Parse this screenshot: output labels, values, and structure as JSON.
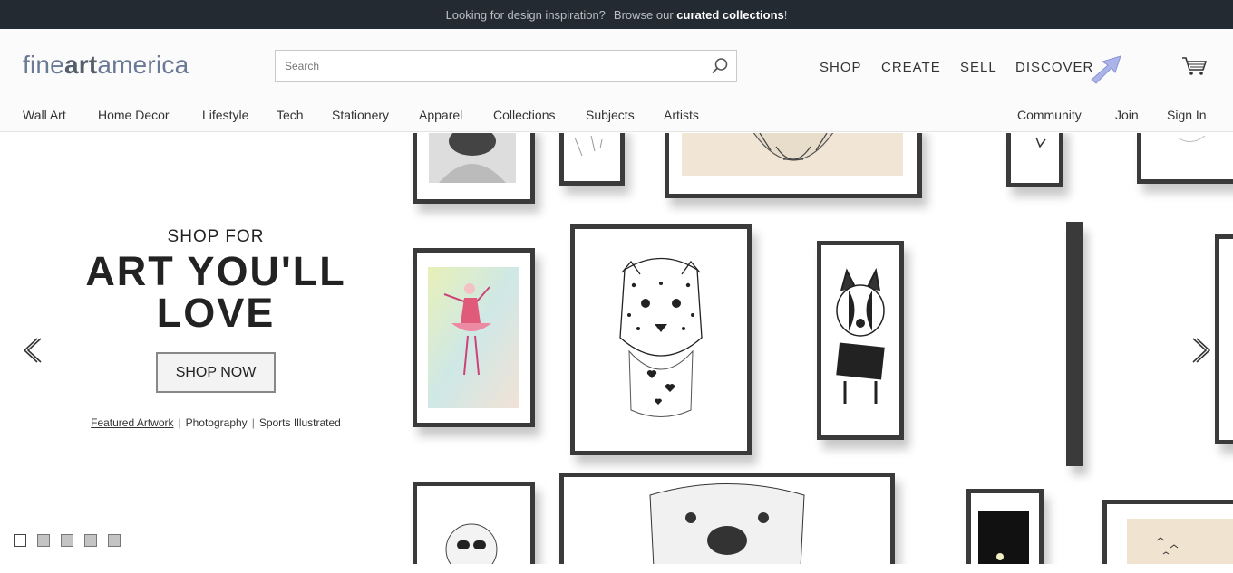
{
  "topbar": {
    "lead": "Looking for design inspiration?",
    "prefix": "Browse our",
    "link": "curated collections",
    "suffix": "!"
  },
  "header": {
    "logo": {
      "part1": "fine",
      "part2": "art",
      "part3": "america"
    },
    "search": {
      "placeholder": "Search",
      "value": ""
    },
    "mainnav": [
      "SHOP",
      "CREATE",
      "SELL",
      "DISCOVER"
    ],
    "subnav_left": [
      "Wall Art",
      "Home Decor",
      "Lifestyle",
      "Tech",
      "Stationery",
      "Apparel",
      "Collections",
      "Subjects",
      "Artists"
    ],
    "subnav_right": [
      "Community",
      "Join",
      "Sign In"
    ]
  },
  "hero": {
    "kicker": "SHOP FOR",
    "headline_line1": "ART YOU'LL",
    "headline_line2": "LOVE",
    "cta": "SHOP NOW",
    "links": [
      "Featured Artwork",
      "Photography",
      "Sports Illustrated"
    ],
    "slides_total": 5,
    "active_slide": 1
  },
  "icons": {
    "search": "search-icon",
    "cart": "cart-icon",
    "prev": "chevron-left-icon",
    "next": "chevron-right-icon"
  },
  "colors": {
    "topbar_bg": "#232a31",
    "logo": "#6a7a96",
    "frame": "#3a3a3a"
  }
}
